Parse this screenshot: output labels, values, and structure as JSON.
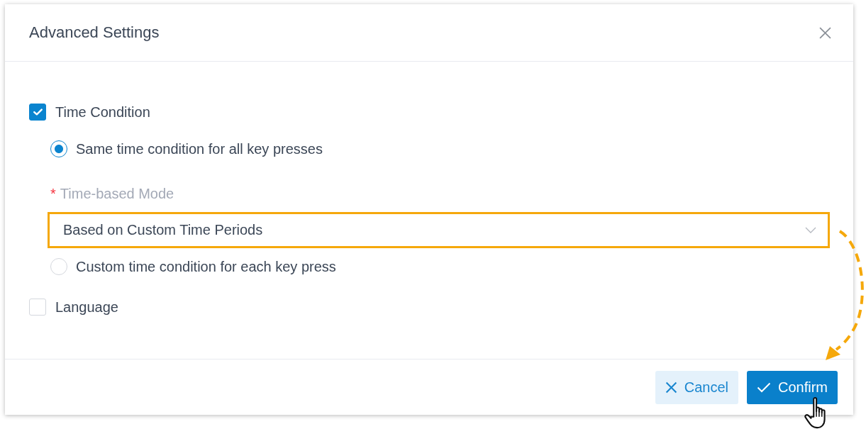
{
  "dialog": {
    "title": "Advanced Settings"
  },
  "options": [
    {
      "kind": "checkbox",
      "label": "Time Condition",
      "checked": true,
      "children": [
        {
          "kind": "radio",
          "label": "Same time condition for all key presses",
          "selected": true,
          "field": {
            "required_mark": "*",
            "label": "Time-based Mode",
            "value": "Based on Custom Time Periods",
            "highlighted": true
          }
        },
        {
          "kind": "radio",
          "label": "Custom time condition for each key press",
          "selected": false
        }
      ]
    },
    {
      "kind": "checkbox",
      "label": "Language",
      "checked": false
    }
  ],
  "buttons": [
    {
      "kind": "cancel",
      "label": "Cancel"
    },
    {
      "kind": "confirm",
      "label": "Confirm"
    }
  ]
}
